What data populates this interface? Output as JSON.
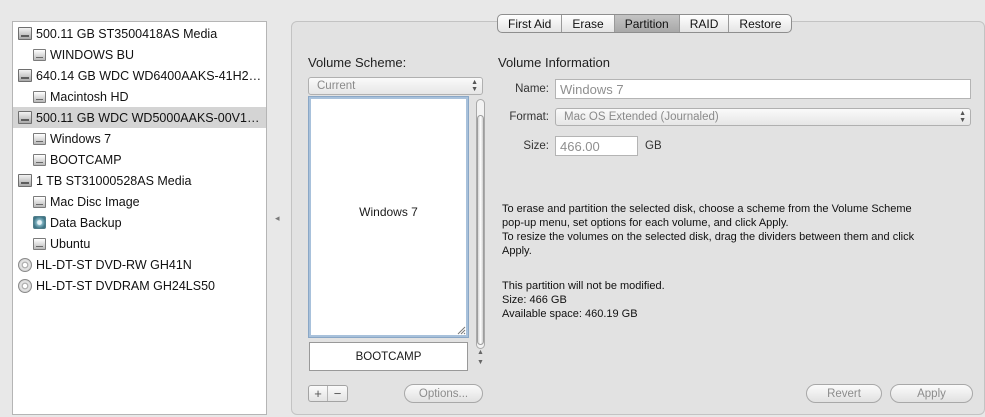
{
  "sidebar": {
    "items": [
      {
        "label": "500.11 GB ST3500418AS Media",
        "icon": "hard-disk-icon",
        "level": 0,
        "selected": false
      },
      {
        "label": "WINDOWS BU",
        "icon": "volume-icon",
        "level": 1,
        "selected": false
      },
      {
        "label": "640.14 GB WDC WD6400AAKS-41H2…",
        "icon": "hard-disk-icon",
        "level": 0,
        "selected": false
      },
      {
        "label": "Macintosh HD",
        "icon": "volume-icon",
        "level": 1,
        "selected": false
      },
      {
        "label": "500.11 GB WDC WD5000AAKS-00V1…",
        "icon": "hard-disk-icon",
        "level": 0,
        "selected": true
      },
      {
        "label": "Windows 7",
        "icon": "volume-icon",
        "level": 1,
        "selected": false
      },
      {
        "label": "BOOTCAMP",
        "icon": "volume-icon",
        "level": 1,
        "selected": false
      },
      {
        "label": "1 TB ST31000528AS Media",
        "icon": "hard-disk-icon",
        "level": 0,
        "selected": false
      },
      {
        "label": "Mac Disc Image",
        "icon": "volume-icon",
        "level": 1,
        "selected": false
      },
      {
        "label": "Data Backup",
        "icon": "disk-image-icon",
        "level": 1,
        "selected": false
      },
      {
        "label": "Ubuntu",
        "icon": "volume-icon",
        "level": 1,
        "selected": false
      },
      {
        "label": "HL-DT-ST DVD-RW GH41N",
        "icon": "optical-drive-icon",
        "level": 0,
        "selected": false
      },
      {
        "label": "HL-DT-ST DVDRAM GH24LS50",
        "icon": "optical-drive-icon",
        "level": 0,
        "selected": false
      }
    ]
  },
  "tabs": [
    {
      "label": "First Aid",
      "active": false
    },
    {
      "label": "Erase",
      "active": false
    },
    {
      "label": "Partition",
      "active": true
    },
    {
      "label": "RAID",
      "active": false
    },
    {
      "label": "Restore",
      "active": false
    }
  ],
  "volume_scheme": {
    "heading": "Volume Scheme:",
    "selected": "Current",
    "partitions": [
      "Windows 7",
      "BOOTCAMP"
    ],
    "add_label": "+",
    "remove_label": "−",
    "options_label": "Options..."
  },
  "volume_info": {
    "heading": "Volume Information",
    "name_label": "Name:",
    "name_value": "Windows 7",
    "format_label": "Format:",
    "format_value": "Mac OS Extended (Journaled)",
    "size_label": "Size:",
    "size_value": "466.00",
    "size_unit": "GB"
  },
  "help_text": {
    "line1": "To erase and partition the selected disk, choose a scheme from the Volume Scheme",
    "line2": "pop-up menu, set options for each volume, and click Apply.",
    "line3": "To resize the volumes on the selected disk, drag the dividers between them and click",
    "line4": "Apply."
  },
  "status": {
    "line1": "This partition will not be modified.",
    "line2": "Size: 466 GB",
    "line3": "Available space: 460.19 GB"
  },
  "buttons": {
    "revert": "Revert",
    "apply": "Apply"
  },
  "colors": {
    "selection": "#d4d4d4",
    "partition_border": "#8aa7c6"
  }
}
